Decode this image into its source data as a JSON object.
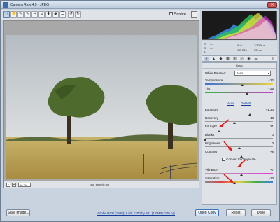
{
  "window": {
    "title": "Camera Raw 4.0  -  JPEG",
    "close_glyph": "✕"
  },
  "toolbar": {
    "tools": [
      {
        "icon": "zoom-tool-icon",
        "glyph": "🔍"
      },
      {
        "icon": "hand-tool-icon",
        "glyph": "✋"
      },
      {
        "icon": "eyedropper-icon",
        "glyph": "✎"
      },
      {
        "icon": "color-sampler-icon",
        "glyph": "✎"
      },
      {
        "icon": "crop-tool-icon",
        "glyph": "⌗"
      },
      {
        "icon": "straighten-tool-icon",
        "glyph": "⊿"
      },
      {
        "icon": "retouch-tool-icon",
        "glyph": "✚"
      },
      {
        "icon": "redeye-tool-icon",
        "glyph": "◉"
      },
      {
        "icon": "preferences-icon",
        "glyph": "☰"
      },
      {
        "icon": "rotate-left-icon",
        "glyph": "↺"
      },
      {
        "icon": "rotate-right-icon",
        "glyph": "↻"
      }
    ],
    "preview_label": "Preview",
    "preview_checked": "✓"
  },
  "canvas": {
    "zoom_minus": "-",
    "zoom_plus": "+",
    "zoom_value": "66.7%",
    "filename": "raw_sample.jpg"
  },
  "info": {
    "r_label": "R:",
    "g_label": "G:",
    "b_label": "B:",
    "r_value": "---",
    "g_value": "---",
    "b_value": "---",
    "aperture": "f/5.6",
    "shutter": "1/1000 s",
    "iso": "ISO 200",
    "focal": "33 mm"
  },
  "panel": {
    "header": "Basic",
    "white_balance_label": "White Balance:",
    "white_balance_value": "Auto",
    "auto_link": "Auto",
    "default_link": "Default",
    "convert_grayscale": "Convert to Grayscale",
    "sliders": [
      {
        "name": "Temperature",
        "value": "+22",
        "level": 0.55
      },
      {
        "name": "Tint",
        "value": "+25",
        "level": 0.62
      },
      {
        "name": "Exposure",
        "value": "+1.30",
        "level": 0.66
      },
      {
        "name": "Recovery",
        "value": "43",
        "level": 0.43
      },
      {
        "name": "Fill Light",
        "value": "21",
        "level": 0.21
      },
      {
        "name": "Blacks",
        "value": "0",
        "level": 0.0
      },
      {
        "name": "Brightness",
        "value": "0",
        "level": 0.5
      },
      {
        "name": "Contrast",
        "value": "+8",
        "level": 0.54
      },
      {
        "name": "Vibrance",
        "value": "+7",
        "level": 0.54
      },
      {
        "name": "Saturation",
        "value": "-13",
        "level": 0.43
      }
    ]
  },
  "bottom": {
    "save_label": "Save Image...",
    "workflow_link": "Adobe RGB (1998); 8 bit; 1200 by 801 (1.0MP); 240 ppi",
    "open_label": "Open Copy",
    "reset_label": "Reset",
    "done_label": "Done"
  },
  "colors": {
    "sky": "#c9cfd4",
    "field": "#b89e52",
    "tree": "#4e6a2c",
    "arrow": "#e21b1b"
  }
}
